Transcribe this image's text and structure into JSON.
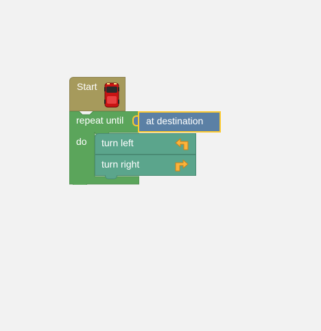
{
  "start": {
    "label": "Start",
    "icon": "car-icon"
  },
  "repeat": {
    "label": "repeat until",
    "do_label": "do"
  },
  "condition": {
    "label": "at destination"
  },
  "turns": [
    {
      "label": "turn left",
      "icon": "turn-left-arrow-icon"
    },
    {
      "label": "turn right",
      "icon": "turn-right-arrow-icon"
    }
  ],
  "colors": {
    "background": "#f2f2f2",
    "start_block": "#a69a5c",
    "loop_block": "#5ba55b",
    "condition_block": "#5b80a5",
    "condition_highlight": "#fcc931",
    "action_block": "#5ba58c",
    "arrow": "#fcb33b"
  }
}
